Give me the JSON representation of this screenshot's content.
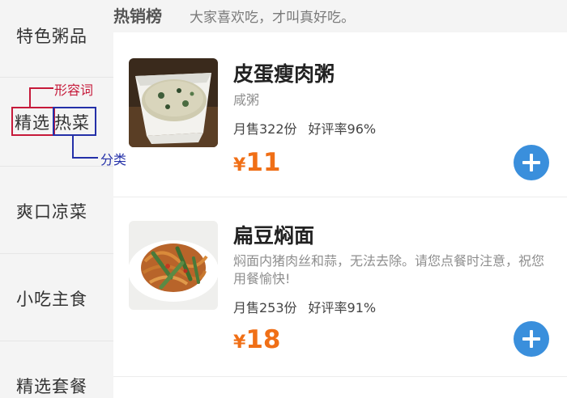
{
  "sidebar": {
    "categories": [
      {
        "label": "特色粥品"
      },
      {
        "label": "精选热菜",
        "part1": "精选",
        "part2": "热菜"
      },
      {
        "label": "爽口凉菜"
      },
      {
        "label": "小吃主食"
      },
      {
        "label": "精选套餐"
      }
    ],
    "annotations": {
      "adjective_label": "形容词",
      "category_label": "分类"
    }
  },
  "section": {
    "title": "热销榜",
    "subtitle": "大家喜欢吃，才叫真好吃。"
  },
  "items": [
    {
      "name": "皮蛋瘦肉粥",
      "description": "咸粥",
      "monthly_sales": "月售322份",
      "rating": "好评率96%",
      "currency": "¥",
      "price": "11",
      "image": "porridge-bowl"
    },
    {
      "name": "扁豆焖面",
      "description": "焖面内猪肉丝和蒜，无法去除。请您点餐时注意，祝您用餐愉快!",
      "monthly_sales": "月售253份",
      "rating": "好评率91%",
      "currency": "¥",
      "price": "18",
      "image": "noodles-plate"
    }
  ],
  "colors": {
    "accent_price": "#f06f16",
    "add_button": "#3a8fdc",
    "annotation_red": "#c61a3a",
    "annotation_blue": "#2430a8"
  },
  "icons": {
    "add": "plus-circle-icon"
  }
}
